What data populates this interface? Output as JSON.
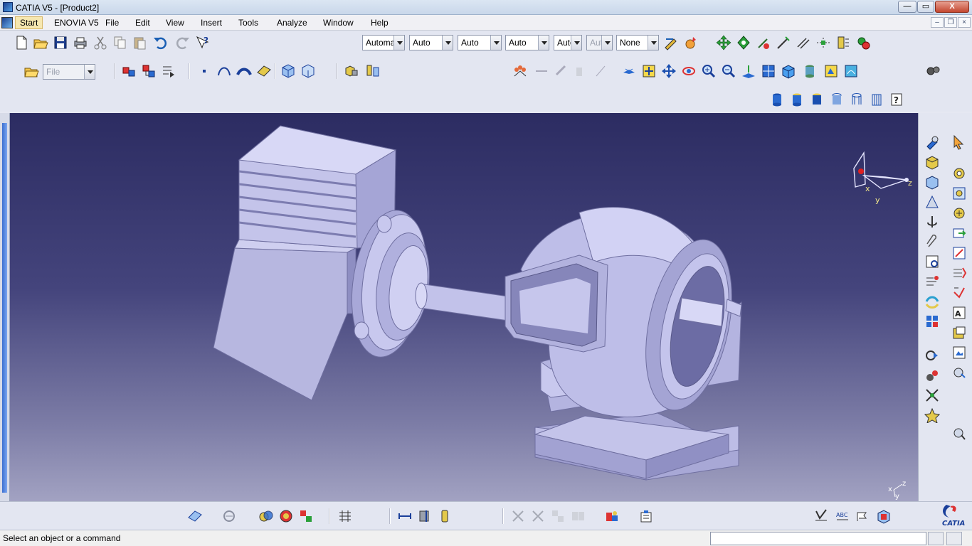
{
  "window": {
    "title": "CATIA V5 - [Product2]",
    "minimize_glyph": "—",
    "maximize_glyph": "▭",
    "close_glyph": "X"
  },
  "menubar": {
    "items": [
      "Start",
      "ENOVIA V5",
      "File",
      "Edit",
      "View",
      "Insert",
      "Tools",
      "Analyze",
      "Window",
      "Help"
    ],
    "mdi_minimize": "–",
    "mdi_restore": "❐",
    "mdi_close": "×"
  },
  "toolbar": {
    "file_combo": "File",
    "graphic_combos": [
      "Automatic",
      "Auto",
      "Auto",
      "Auto",
      "Auto",
      "Auto"
    ],
    "layer_combo": "None"
  },
  "viewport": {
    "compass_labels": {
      "x": "x",
      "y": "y",
      "z": "z"
    },
    "axis_labels": {
      "x": "x",
      "y": "y",
      "z": "z"
    }
  },
  "status": {
    "message": "Select an object or a command",
    "command_value": ""
  },
  "brand": {
    "logo_text": "CATIA"
  },
  "colors": {
    "viewport_top": "#2c2c62",
    "viewport_bottom": "#a2a2c2",
    "part": "#b8b8e2",
    "part_shadow": "#8e8ec2",
    "part_highlight": "#d8d8f4"
  }
}
